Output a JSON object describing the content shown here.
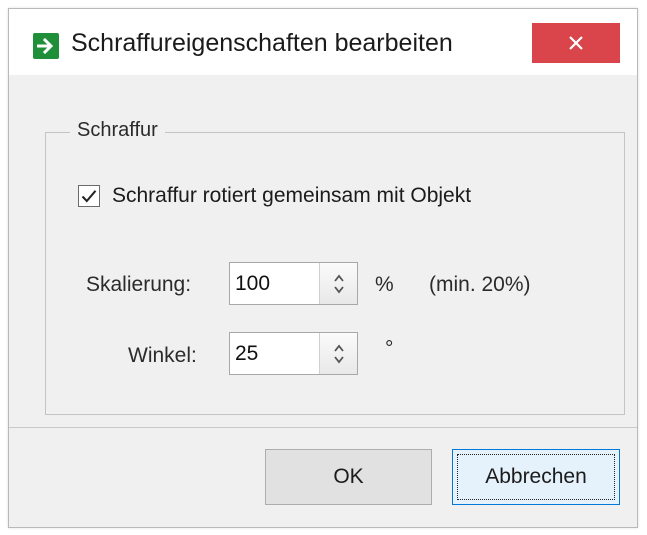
{
  "window": {
    "title": "Schraffureigenschaften bearbeiten",
    "close_glyph": "×"
  },
  "group": {
    "title": "Schraffur",
    "rotate_checkbox": {
      "label": "Schraffur rotiert gemeinsam mit Objekt",
      "checked": true
    },
    "scale": {
      "label": "Skalierung:",
      "value": "100",
      "unit": "%",
      "hint": "(min. 20%)"
    },
    "angle": {
      "label": "Winkel:",
      "value": "25",
      "unit": "°"
    }
  },
  "buttons": {
    "ok": "OK",
    "cancel": "Abbrechen"
  },
  "icons": {
    "app": "arrow-right-icon",
    "close": "close-icon",
    "check": "checkmark-icon",
    "spin": "spinner-arrows-icon"
  },
  "colors": {
    "app_icon": "#1f8f3a",
    "close_button": "#d9454a",
    "focus": "#0078d7"
  }
}
